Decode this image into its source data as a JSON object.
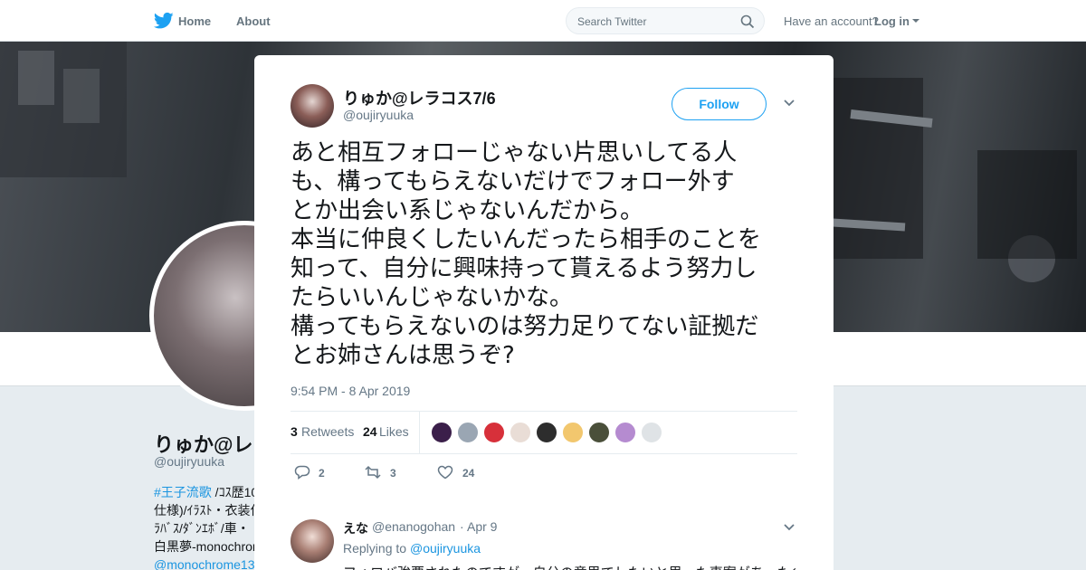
{
  "nav": {
    "home_label": "Home",
    "about_label": "About",
    "search_placeholder": "Search Twitter",
    "have_account": "Have an account?",
    "login_label": "Log in",
    "icons": [
      "twitter-bird-icon",
      "search-icon",
      "caret-down-icon",
      "close-icon"
    ],
    "brand_color": "#1da1f2"
  },
  "background_profile": {
    "name": "りゅか@レ",
    "handle": "@oujiryuuka",
    "bio_lines": [
      "#王子流歌 /ｺｽ歴10",
      "仕様)/ｲﾗｽﾄ・衣装作",
      "ﾗﾊﾞｽ/ﾀﾞﾝｴﾎﾞ/車・",
      "白黒夢-monochrom",
      "@monochrome13"
    ],
    "bio_hashtag": "#王子流歌",
    "bio_rest_first": " /ｺｽ歴10"
  },
  "tweet": {
    "author_name": "りゅか@レラコス7/6",
    "author_handle": "@oujiryuuka",
    "follow_label": "Follow",
    "text_lines": [
      "あと相互フォローじゃない片思いしてる人",
      "も、構ってもらえないだけでフォロー外す",
      "とか出会い系じゃないんだから。",
      "本当に仲良くしたいんだったら相手のことを",
      "知って、自分に興味持って貰えるよう努力し",
      "たらいいんじゃないかな。",
      "構ってもらえないのは努力足りてない証拠だ",
      "とお姉さんは思うぞ?"
    ],
    "timestamp": "9:54 PM - 8 Apr 2019",
    "retweets_count": "3",
    "retweets_label": "Retweets",
    "likes_count": "24",
    "likes_label": "Likes",
    "liker_colors": [
      "#3b1f4a",
      "#9aa6b3",
      "#d7303a",
      "#e9ddd6",
      "#2d2d2d",
      "#f2c76e",
      "#4a4f3a",
      "#b58bd0",
      "#dfe3e6"
    ],
    "reply_count": "2",
    "retweet_action_count": "3",
    "like_action_count": "24"
  },
  "reply": {
    "name": "えな",
    "handle": "@enanogohan",
    "dot": "·",
    "date": "Apr 9",
    "replying_to_label": "Replying to",
    "replying_to_handle": "@oujiryuuka",
    "text": "フォロバ強要されたのですが、自分の意思でしたいと思った事案があったの"
  }
}
